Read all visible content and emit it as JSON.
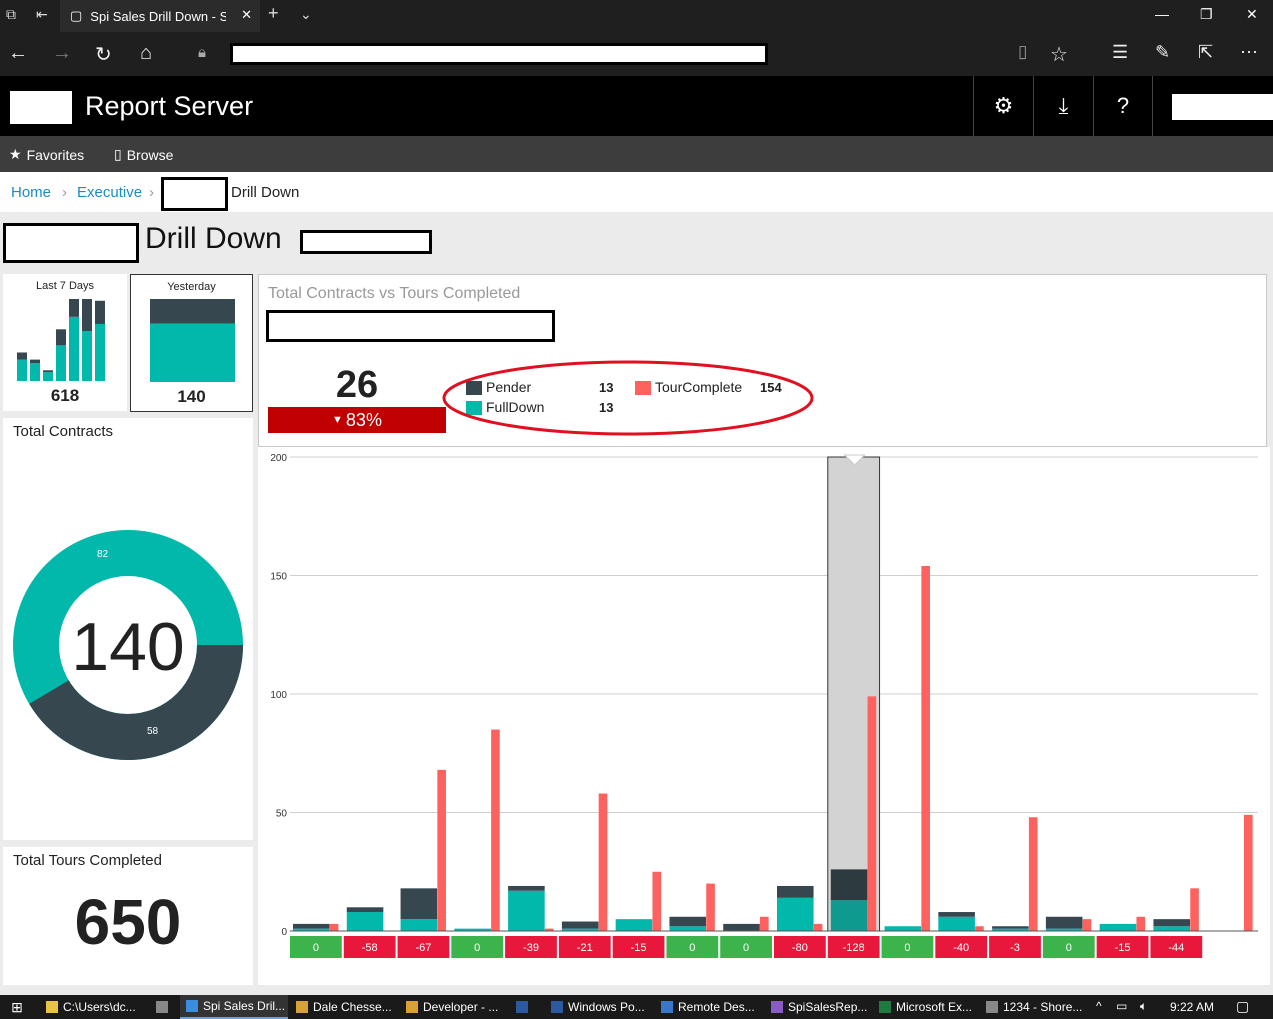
{
  "browser": {
    "tab_title": "Spi Sales Drill Down - S(",
    "new_tab": "+",
    "icons": [
      "tab-manager-icon",
      "back-tabs-icon",
      "page-icon",
      "close-icon",
      "new-tab-icon",
      "chevron-down-icon",
      "minimize-icon",
      "maximize-icon",
      "close-window-icon",
      "back-icon",
      "forward-icon",
      "refresh-icon",
      "home-icon",
      "lock-icon",
      "reading-view-icon",
      "favorite-star-icon",
      "favorites-hub-icon",
      "pen-icon",
      "share-icon",
      "more-icon"
    ]
  },
  "header": {
    "title": "Report Server",
    "icons": [
      "gear-icon",
      "download-icon",
      "help-icon"
    ],
    "help_label": "?"
  },
  "menu": {
    "favorites": "Favorites",
    "browse": "Browse"
  },
  "breadcrumb": {
    "home": "Home",
    "executive": "Executive",
    "current": "Drill Down"
  },
  "page": {
    "title": "Drill Down"
  },
  "tiles": {
    "last7": {
      "label": "Last 7 Days",
      "value": "618",
      "bars": [
        {
          "dark": 4,
          "teal": 12
        },
        {
          "dark": 2,
          "teal": 10
        },
        {
          "dark": 1,
          "teal": 5
        },
        {
          "dark": 9,
          "teal": 20
        },
        {
          "dark": 10,
          "teal": 36
        },
        {
          "dark": 18,
          "teal": 28
        },
        {
          "dark": 13,
          "teal": 32
        }
      ]
    },
    "yesterday": {
      "label": "Yesterday",
      "value": "140",
      "dark": 58,
      "teal": 82
    },
    "contracts": {
      "label": "Total Contracts",
      "value": "140",
      "teal_value": "82",
      "dark_value": "58"
    },
    "tours": {
      "label": "Total Tours Completed",
      "value": "650"
    }
  },
  "kpi": {
    "title": "Total Contracts vs Tours Completed",
    "value": "26",
    "change": "83%",
    "change_arrow": "▼",
    "legend": [
      {
        "name": "Pender",
        "value": "13",
        "color": "#36474f"
      },
      {
        "name": "FullDown",
        "value": "13",
        "color": "#01b8aa"
      },
      {
        "name": "TourComplete",
        "value": "154",
        "color": "#fd625e"
      }
    ]
  },
  "colors": {
    "teal": "#01b8aa",
    "dark": "#36474f",
    "red": "#fd625e",
    "kpi_red": "#c00000",
    "green_cell": "#3cb44b",
    "red_cell": "#e8173c"
  },
  "chart_data": {
    "type": "bar",
    "yticks": [
      "0",
      "50",
      "100",
      "150",
      "200"
    ],
    "ylim": [
      0,
      200
    ],
    "stacked_series": [
      {
        "name": "FullDown",
        "values": [
          1,
          8,
          5,
          1,
          17,
          1,
          5,
          2,
          0,
          14,
          13,
          2,
          6,
          1,
          1,
          3,
          2
        ]
      },
      {
        "name": "Pender",
        "values": [
          2,
          2,
          13,
          0,
          2,
          3,
          0,
          4,
          3,
          5,
          13,
          0,
          2,
          1,
          5,
          0,
          3
        ]
      }
    ],
    "tour_series": {
      "name": "TourComplete",
      "values": [
        3,
        0,
        68,
        85,
        1,
        58,
        25,
        20,
        6,
        3,
        99,
        154,
        2,
        48,
        5,
        6,
        18,
        49
      ]
    },
    "groups": 18,
    "selected_group": 10,
    "diff_row": [
      "0",
      "-58",
      "-67",
      "0",
      "-39",
      "-21",
      "-15",
      "0",
      "0",
      "-80",
      "-128",
      "0",
      "-40",
      "-3",
      "0",
      "-15",
      "-44"
    ],
    "diff_positive": [
      true,
      false,
      false,
      true,
      false,
      false,
      false,
      true,
      true,
      false,
      false,
      true,
      false,
      false,
      true,
      false,
      false
    ]
  },
  "taskbar": {
    "items": [
      {
        "label": "C:\\Users\\dc...",
        "icon": "folder-icon"
      },
      {
        "label": "",
        "icon": "app-icon"
      },
      {
        "label": "Spi Sales Dril...",
        "icon": "edge-icon"
      },
      {
        "label": "Dale Chesse...",
        "icon": "chrome-icon"
      },
      {
        "label": "Developer - ...",
        "icon": "chrome-icon"
      },
      {
        "label": "",
        "icon": "powershell-icon"
      },
      {
        "label": "Windows Po...",
        "icon": "powershell-icon"
      },
      {
        "label": "Remote Des...",
        "icon": "remote-desktop-icon"
      },
      {
        "label": "SpiSalesRep...",
        "icon": "visual-studio-icon"
      },
      {
        "label": "Microsoft Ex...",
        "icon": "excel-icon"
      },
      {
        "label": "1234 - Shore...",
        "icon": "app-icon"
      }
    ],
    "time": "9:22 AM"
  }
}
